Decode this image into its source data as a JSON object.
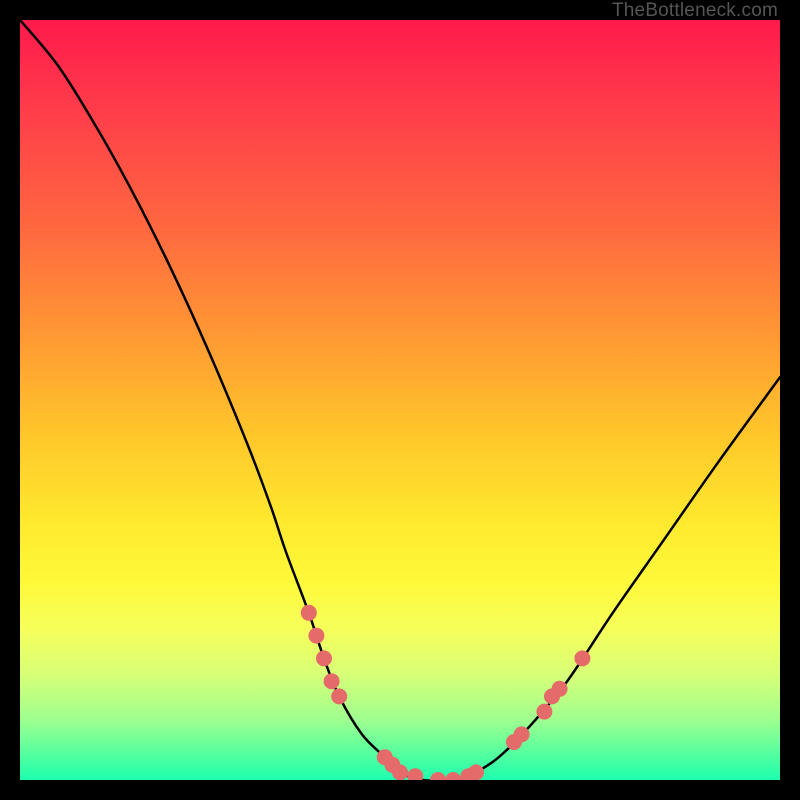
{
  "watermark": "TheBottleneck.com",
  "chart_data": {
    "type": "line",
    "title": "",
    "xlabel": "",
    "ylabel": "",
    "xlim": [
      0,
      100
    ],
    "ylim": [
      0,
      100
    ],
    "series": [
      {
        "name": "bottleneck-curve",
        "x": [
          0,
          5,
          10,
          15,
          20,
          25,
          30,
          33,
          35,
          38,
          40,
          42,
          45,
          48,
          50,
          53,
          55,
          58,
          60,
          63,
          67,
          72,
          78,
          85,
          92,
          100
        ],
        "y": [
          100,
          94,
          86,
          77,
          67,
          56,
          44,
          36,
          30,
          22,
          16,
          11,
          6,
          3,
          1,
          0,
          0,
          0,
          1,
          3,
          7,
          13,
          22,
          32,
          42,
          53
        ]
      }
    ],
    "markers": {
      "name": "highlight-dots",
      "color": "#e56a6a",
      "points": [
        {
          "x": 38,
          "y": 22
        },
        {
          "x": 39,
          "y": 19
        },
        {
          "x": 40,
          "y": 16
        },
        {
          "x": 41,
          "y": 13
        },
        {
          "x": 42,
          "y": 11
        },
        {
          "x": 48,
          "y": 3
        },
        {
          "x": 49,
          "y": 2
        },
        {
          "x": 50,
          "y": 1
        },
        {
          "x": 52,
          "y": 0.5
        },
        {
          "x": 55,
          "y": 0
        },
        {
          "x": 57,
          "y": 0
        },
        {
          "x": 59,
          "y": 0.5
        },
        {
          "x": 60,
          "y": 1
        },
        {
          "x": 65,
          "y": 5
        },
        {
          "x": 66,
          "y": 6
        },
        {
          "x": 69,
          "y": 9
        },
        {
          "x": 70,
          "y": 11
        },
        {
          "x": 71,
          "y": 12
        },
        {
          "x": 74,
          "y": 16
        }
      ]
    }
  }
}
